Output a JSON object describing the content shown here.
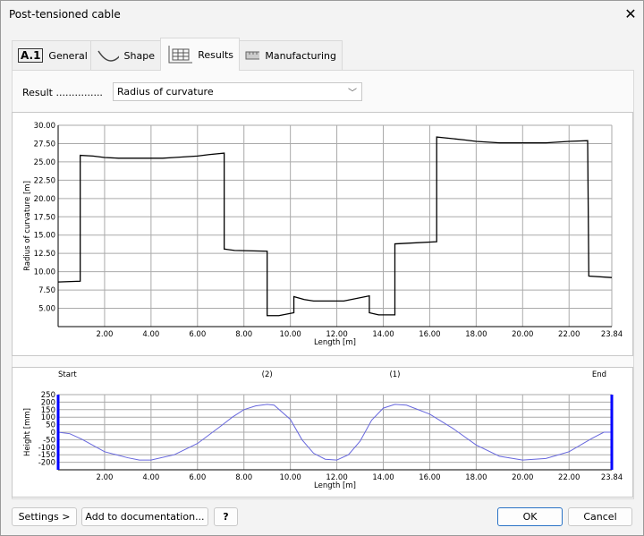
{
  "window": {
    "title": "Post-tensioned cable"
  },
  "tabs": [
    {
      "label": "General",
      "icon_text": "A.1"
    },
    {
      "label": "Shape"
    },
    {
      "label": "Results"
    },
    {
      "label": "Manufacturing"
    }
  ],
  "result": {
    "label": "Result ...............",
    "selected": "Radius of curvature"
  },
  "buttons": {
    "settings": "Settings >",
    "add_doc": "Add to documentation...",
    "help": "?",
    "ok": "OK",
    "cancel": "Cancel"
  },
  "chart_data": [
    {
      "type": "line",
      "title": "",
      "xlabel": "Length [m]",
      "ylabel": "Radius of curvature [m]",
      "xlim": [
        0,
        23.84
      ],
      "ylim": [
        2.5,
        30
      ],
      "xticks": [
        "2.00",
        "4.00",
        "6.00",
        "8.00",
        "10.00",
        "12.00",
        "14.00",
        "16.00",
        "18.00",
        "20.00",
        "22.00",
        "23.84"
      ],
      "yticks": [
        "30.00",
        "27.50",
        "25.00",
        "22.50",
        "20.00",
        "17.50",
        "15.00",
        "12.50",
        "10.00",
        "7.50",
        "5.00"
      ],
      "points": [
        [
          0,
          8.6
        ],
        [
          0.95,
          8.7
        ],
        [
          0.95,
          25.9
        ],
        [
          1.5,
          25.8
        ],
        [
          2,
          25.6
        ],
        [
          2.6,
          25.5
        ],
        [
          4.5,
          25.5
        ],
        [
          5,
          25.6
        ],
        [
          6,
          25.8
        ],
        [
          6.5,
          26.0
        ],
        [
          7.15,
          26.2
        ],
        [
          7.15,
          13.1
        ],
        [
          7.6,
          12.9
        ],
        [
          9.0,
          12.8
        ],
        [
          9.0,
          4.0
        ],
        [
          9.5,
          4.0
        ],
        [
          10.15,
          4.4
        ],
        [
          10.15,
          6.6
        ],
        [
          10.6,
          6.2
        ],
        [
          11.0,
          6.0
        ],
        [
          12.3,
          6.0
        ],
        [
          13.4,
          6.7
        ],
        [
          13.4,
          4.4
        ],
        [
          13.8,
          4.1
        ],
        [
          14.5,
          4.1
        ],
        [
          14.5,
          13.8
        ],
        [
          16.3,
          14.1
        ],
        [
          16.3,
          28.4
        ],
        [
          17.5,
          28.0
        ],
        [
          18,
          27.8
        ],
        [
          19,
          27.6
        ],
        [
          21,
          27.6
        ],
        [
          22,
          27.8
        ],
        [
          22.8,
          27.9
        ],
        [
          22.85,
          9.4
        ],
        [
          23.84,
          9.2
        ]
      ]
    },
    {
      "type": "line",
      "title": "",
      "xlabel": "Length [m]",
      "ylabel": "Height [mm]",
      "xlim": [
        0,
        23.84
      ],
      "ylim": [
        -250,
        250
      ],
      "xticks": [
        "2.00",
        "4.00",
        "6.00",
        "8.00",
        "10.00",
        "12.00",
        "14.00",
        "16.00",
        "18.00",
        "20.00",
        "22.00",
        "23.84"
      ],
      "yticks": [
        "250",
        "200",
        "150",
        "100",
        "50",
        "0",
        "-50",
        "-100",
        "-150",
        "-200"
      ],
      "annotations": [
        {
          "x": 0,
          "label": "Start"
        },
        {
          "x": 9.0,
          "label": "(2)"
        },
        {
          "x": 14.5,
          "label": "(1)"
        },
        {
          "x": 23.84,
          "label": "End"
        }
      ],
      "series_color": "#6666dd",
      "boundary_color": "#0000ff",
      "points": [
        [
          0,
          0
        ],
        [
          0.5,
          -10
        ],
        [
          1,
          -45
        ],
        [
          2,
          -130
        ],
        [
          3,
          -170
        ],
        [
          3.5,
          -185
        ],
        [
          4,
          -185
        ],
        [
          5,
          -150
        ],
        [
          6,
          -75
        ],
        [
          7,
          40
        ],
        [
          7.5,
          100
        ],
        [
          8,
          150
        ],
        [
          8.5,
          175
        ],
        [
          9,
          185
        ],
        [
          9.3,
          180
        ],
        [
          10,
          85
        ],
        [
          10.5,
          -50
        ],
        [
          11,
          -140
        ],
        [
          11.5,
          -180
        ],
        [
          12,
          -185
        ],
        [
          12.5,
          -150
        ],
        [
          13,
          -60
        ],
        [
          13.5,
          80
        ],
        [
          14,
          160
        ],
        [
          14.5,
          185
        ],
        [
          15,
          180
        ],
        [
          16,
          120
        ],
        [
          17,
          25
        ],
        [
          18,
          -85
        ],
        [
          19,
          -160
        ],
        [
          20,
          -185
        ],
        [
          21,
          -175
        ],
        [
          22,
          -130
        ],
        [
          23,
          -40
        ],
        [
          23.5,
          0
        ],
        [
          23.84,
          0
        ]
      ]
    }
  ]
}
